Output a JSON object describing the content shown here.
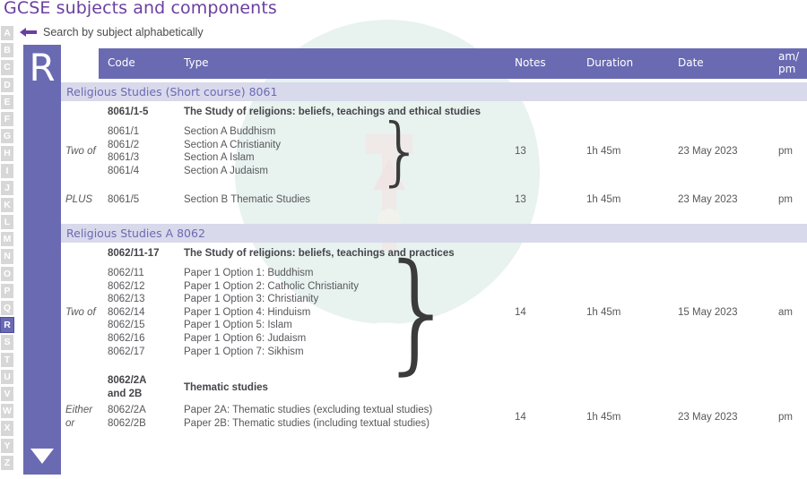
{
  "page": {
    "title": "GCSE subjects and components",
    "search_hint": "Search by subject alphabetically",
    "back_arrow_icon": "arrow-left-icon",
    "watermark_text": "TestDaily"
  },
  "alphabet": {
    "letters": [
      "A",
      "B",
      "C",
      "D",
      "E",
      "F",
      "G",
      "H",
      "I",
      "J",
      "K",
      "L",
      "M",
      "N",
      "O",
      "P",
      "Q",
      "R",
      "S",
      "T",
      "U",
      "V",
      "W",
      "X",
      "Y",
      "Z"
    ],
    "active": "R"
  },
  "letter_panel": {
    "letter": "R",
    "scroll_down_icon": "triangle-down-icon"
  },
  "table": {
    "columns": [
      {
        "key": "code",
        "label": "Code"
      },
      {
        "key": "type",
        "label": "Type"
      },
      {
        "key": "notes",
        "label": "Notes"
      },
      {
        "key": "duration",
        "label": "Duration"
      },
      {
        "key": "date",
        "label": "Date"
      },
      {
        "key": "ampm",
        "label": "am/\npm",
        "line1": "am/",
        "line2": "pm"
      }
    ],
    "sections": [
      {
        "title": "Religious Studies (Short course)  8061",
        "groups": [
          {
            "heading_code": "8061/1-5",
            "heading_type": "The Study of religions: beliefs, teachings and ethical studies",
            "qualifier": "Two of",
            "has_brace": true,
            "rows": [
              {
                "code": "8061/1",
                "type": "Section A Buddhism"
              },
              {
                "code": "8061/2",
                "type": "Section A Christianity"
              },
              {
                "code": "8061/3",
                "type": "Section A Islam"
              },
              {
                "code": "8061/4",
                "type": "Section A Judaism"
              }
            ],
            "notes": "13",
            "duration": "1h 45m",
            "date": "23 May 2023",
            "ampm": "pm"
          },
          {
            "heading_code": "",
            "heading_type": "",
            "qualifier": "PLUS",
            "has_brace": false,
            "rows": [
              {
                "code": "8061/5",
                "type": "Section B Thematic Studies"
              }
            ],
            "notes": "13",
            "duration": "1h 45m",
            "date": "23 May 2023",
            "ampm": "pm"
          }
        ]
      },
      {
        "title": "Religious Studies A  8062",
        "groups": [
          {
            "heading_code": "8062/11-17",
            "heading_type": "The Study of religions: beliefs, teachings and practices",
            "qualifier": "Two of",
            "has_brace": true,
            "rows": [
              {
                "code": "8062/11",
                "type": "Paper 1 Option 1: Buddhism"
              },
              {
                "code": "8062/12",
                "type": "Paper 1 Option 2: Catholic Christianity"
              },
              {
                "code": "8062/13",
                "type": "Paper 1 Option 3: Christianity"
              },
              {
                "code": "8062/14",
                "type": "Paper 1 Option 4: Hinduism"
              },
              {
                "code": "8062/15",
                "type": "Paper 1 Option 5: Islam"
              },
              {
                "code": "8062/16",
                "type": "Paper 1 Option 6: Judaism"
              },
              {
                "code": "8062/17",
                "type": "Paper 1 Option 7: Sikhism"
              }
            ],
            "notes": "14",
            "duration": "1h 45m",
            "date": "15 May 2023",
            "ampm": "am"
          },
          {
            "heading_code": "8062/2A\nand 2B",
            "heading_code_line1": "8062/2A",
            "heading_code_line2": "and 2B",
            "heading_type": "Thematic studies",
            "qualifier": "Either\nor",
            "qualifier_line1": "Either",
            "qualifier_line2": "or",
            "has_brace": false,
            "rows": [
              {
                "code": "8062/2A",
                "type": "Paper 2A: Thematic studies (excluding textual studies)"
              },
              {
                "code": "8062/2B",
                "type": "Paper 2B: Thematic studies (including textual studies)"
              }
            ],
            "notes": "14",
            "duration": "1h 45m",
            "date": "23 May 2023",
            "ampm": "pm"
          }
        ]
      }
    ]
  },
  "colors": {
    "brand_purple": "#6b3fa0",
    "header_blue": "#6a6ab3",
    "section_bar": "#d9d9ec",
    "text_grey": "#58585c",
    "watermark_teal": "#e4f0ec"
  }
}
